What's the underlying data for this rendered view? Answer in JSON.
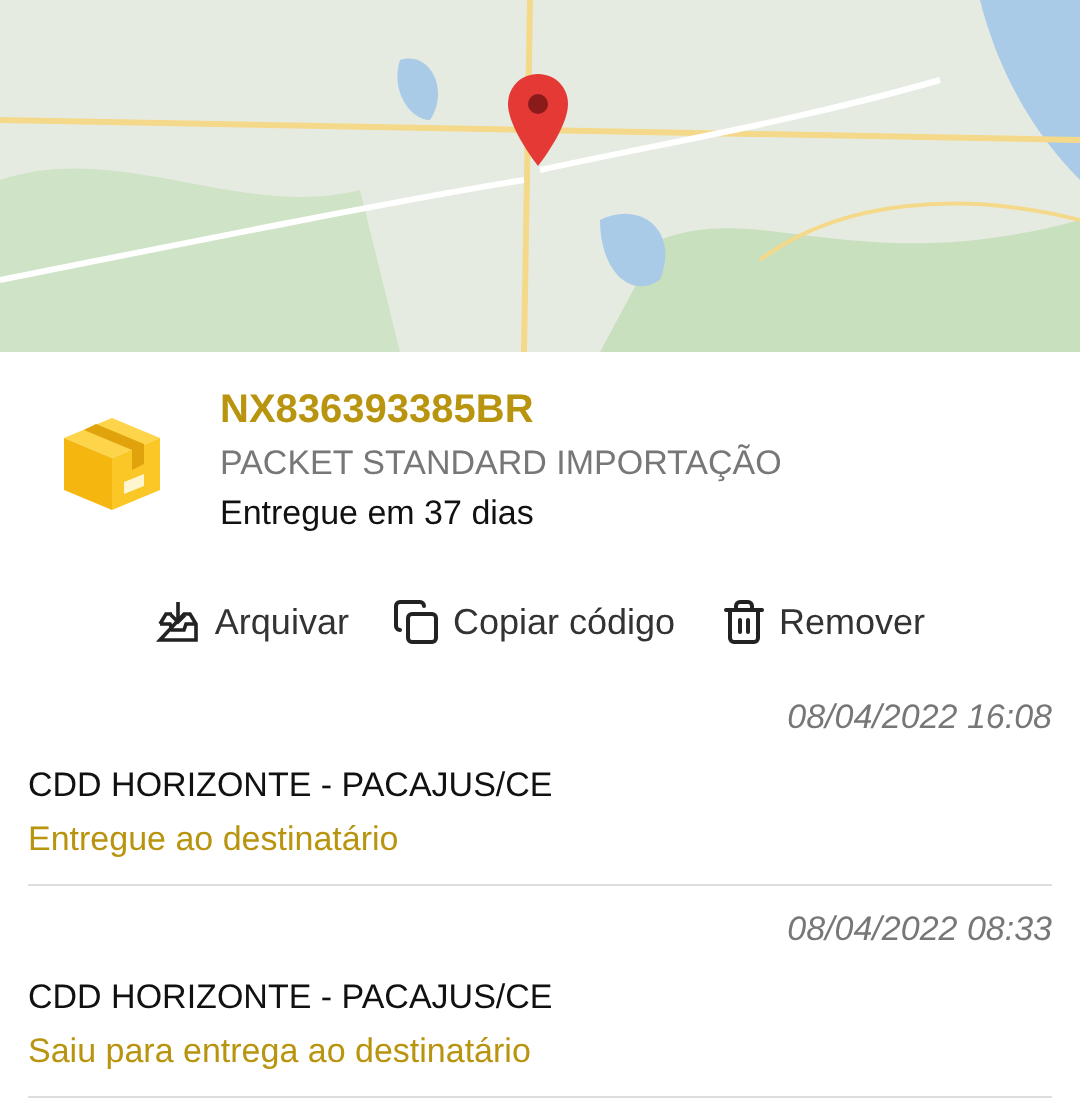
{
  "package": {
    "code": "NX836393385BR",
    "service": "PACKET STANDARD IMPORTAÇÃO",
    "summary": "Entregue em 37 dias"
  },
  "actions": [
    {
      "kind": "archive",
      "label": "Arquivar"
    },
    {
      "kind": "copy",
      "label": "Copiar código"
    },
    {
      "kind": "remove",
      "label": "Remover"
    }
  ],
  "events": [
    {
      "datetime": "08/04/2022 16:08",
      "location": "CDD HORIZONTE - PACAJUS/CE",
      "status": "Entregue ao destinatário"
    },
    {
      "datetime": "08/04/2022 08:33",
      "location": "CDD HORIZONTE - PACAJUS/CE",
      "status": "Saiu para entrega ao destinatário"
    }
  ]
}
